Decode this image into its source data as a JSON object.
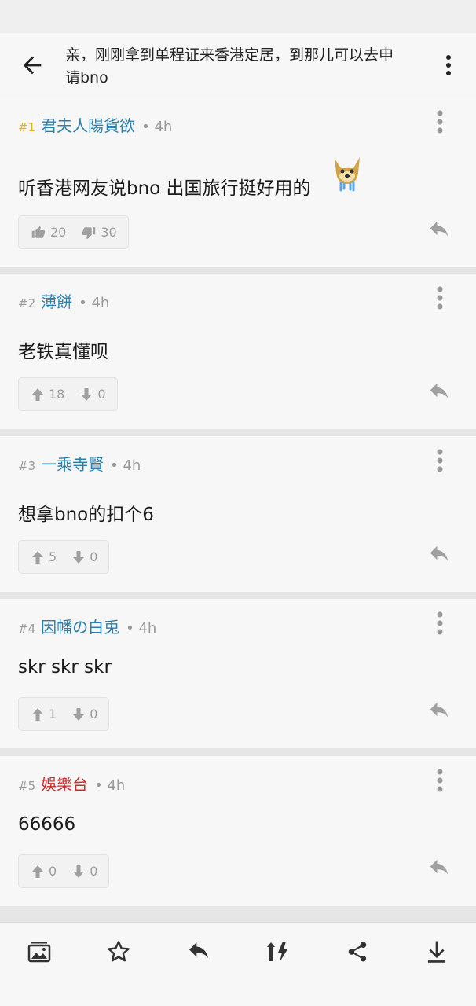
{
  "header": {
    "title": "亲，刚刚拿到单程证来香港定居，到那儿可以去申请bno"
  },
  "replies": [
    {
      "floor": "#1",
      "user": "君夫人陽貨欲",
      "time": "• 4h",
      "content": "听香港网友说bno 出国旅行挺好用的",
      "up": "20",
      "down": "30"
    },
    {
      "floor": "#2",
      "user": "薄餅",
      "time": "• 4h",
      "content": "老铁真懂呗",
      "up": "18",
      "down": "0"
    },
    {
      "floor": "#3",
      "user": "一乘寺賢",
      "time": "• 4h",
      "content": "想拿bno的扣个6",
      "up": "5",
      "down": "0"
    },
    {
      "floor": "#4",
      "user": "因幡の白兎",
      "time": "• 4h",
      "content": "skr skr skr",
      "up": "1",
      "down": "0"
    },
    {
      "floor": "#5",
      "user": "娛樂台",
      "time": "• 4h",
      "content": "66666",
      "up": "0",
      "down": "0"
    }
  ],
  "colors": {
    "username": "#2a7fae",
    "username_highlight": "#cc2a2a",
    "first_floor": "#e9b01e",
    "background": "#f7f7f7",
    "divider": "#e6e6e6"
  },
  "icons": {
    "back": "arrow-left-icon",
    "menu": "more-vertical-icon",
    "like": "thumbs-up-icon",
    "dislike": "thumbs-down-icon",
    "upvote": "arrow-up-icon",
    "downvote": "arrow-down-icon",
    "reply": "reply-icon",
    "bottom": [
      "image-icon",
      "star-icon",
      "reply-icon",
      "sort-icon",
      "share-icon",
      "download-icon"
    ]
  }
}
